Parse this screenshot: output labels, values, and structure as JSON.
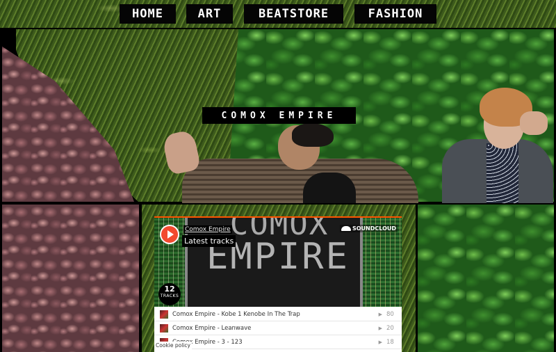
{
  "nav": {
    "items": [
      {
        "label": "HOME"
      },
      {
        "label": "ART"
      },
      {
        "label": "BEATSTORE"
      },
      {
        "label": "FASHION"
      }
    ]
  },
  "hero": {
    "band_name": "COMOX EMPIRE"
  },
  "soundcloud": {
    "artist": "Comox Empire",
    "subtitle": "Latest tracks",
    "logo_text": "SOUNDCLOUD",
    "artwork_text_top": "COMOX",
    "artwork_text": "EMPIRE",
    "track_count": "12",
    "track_count_label": "TRACKS",
    "tracks": [
      {
        "title": "Comox Empire - Kobe 1 Kenobe In The Trap",
        "plays": "80"
      },
      {
        "title": "Comox Empire - Leanwave",
        "plays": "20"
      },
      {
        "title": "Comox Empire - 3 - 123",
        "plays": "18"
      }
    ],
    "cookie_policy": "Cookie policy",
    "colors": {
      "accent": "#ff5500",
      "play_button": "#f24a2f"
    }
  }
}
